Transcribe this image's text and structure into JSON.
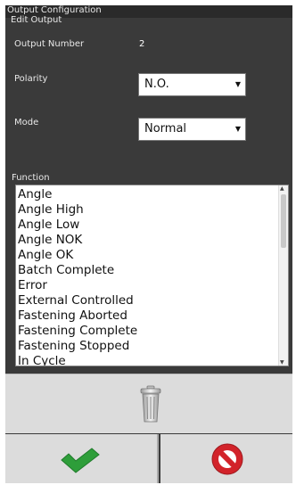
{
  "window": {
    "title": "Output Configuration",
    "subtitle": "Edit Output"
  },
  "output_number": {
    "label": "Output Number",
    "value": "2"
  },
  "polarity": {
    "label": "Polarity",
    "selected": "N.O."
  },
  "mode": {
    "label": "Mode",
    "selected": "Normal"
  },
  "function": {
    "label": "Function",
    "items": [
      "Angle",
      "Angle High",
      "Angle Low",
      "Angle NOK",
      "Angle OK",
      "Batch Complete",
      "Error",
      "External Controlled",
      "Fastening Aborted",
      "Fastening Complete",
      "Fastening Stopped",
      "In Cycle"
    ]
  },
  "icons": {
    "delete": "trash-icon",
    "confirm": "checkmark-icon",
    "cancel": "cancel-icon"
  },
  "colors": {
    "background": "#3a3a3a",
    "confirm": "#2e9e3a",
    "cancel": "#d2232a"
  }
}
